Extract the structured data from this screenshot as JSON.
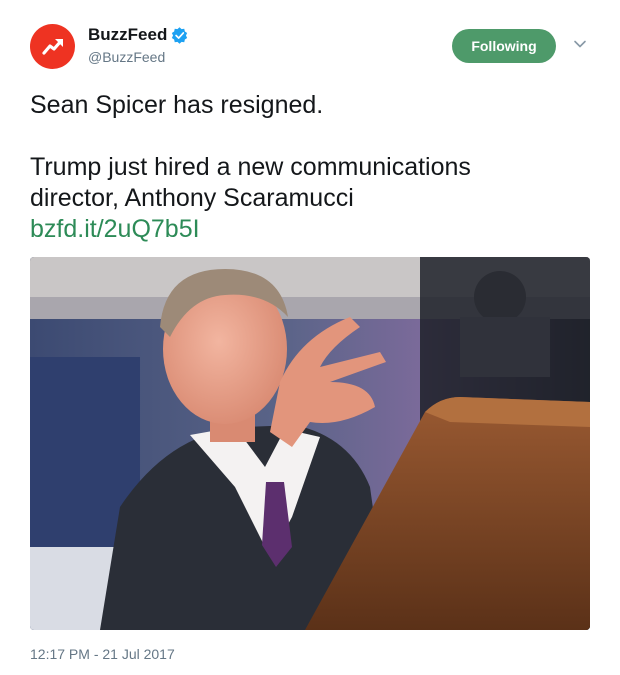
{
  "account": {
    "display_name": "BuzzFeed",
    "handle": "@BuzzFeed",
    "avatar_icon": "buzzfeed-trending-arrow-icon",
    "avatar_color": "#ee3322",
    "verified_icon": "verified-badge-icon",
    "verified_color": "#1da1f2"
  },
  "follow_button": {
    "label": "Following",
    "color": "#4e9a6a"
  },
  "menu_icon": "chevron-down-icon",
  "tweet": {
    "line1": "Sean Spicer has resigned.",
    "line2": "Trump just hired a new communications",
    "line3": "director, Anthony Scaramucci",
    "link": "bzfd.it/2uQ7b5I",
    "link_color": "#2d8b57"
  },
  "media": {
    "type": "photo"
  },
  "timestamp": "12:17 PM - 21 Jul 2017"
}
